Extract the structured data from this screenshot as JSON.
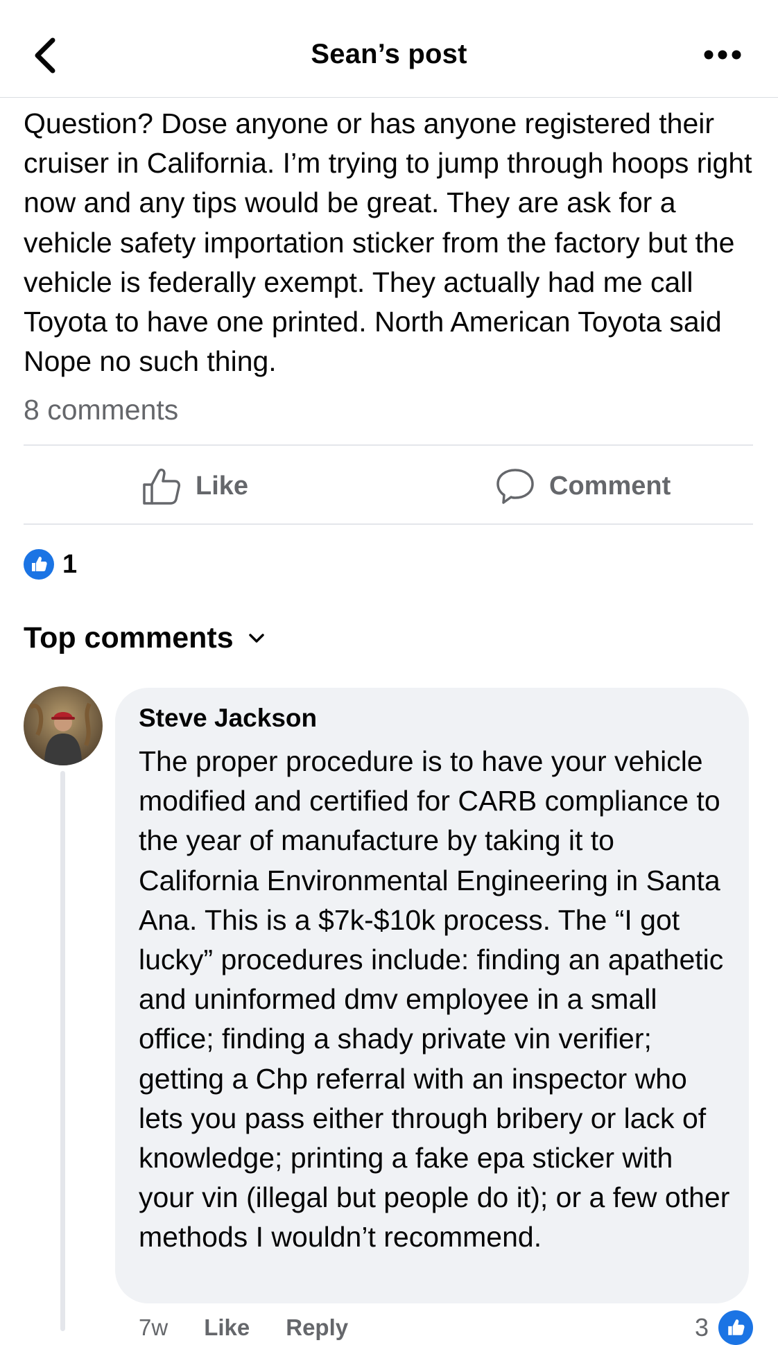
{
  "header": {
    "title": "Sean’s post",
    "back_icon": "chevron-left-icon",
    "more_icon": "ellipsis-icon"
  },
  "post": {
    "text": "Question? Dose anyone or has anyone registered their cruiser in California. I’m trying to jump through hoops right now and any tips would be great. They are ask for a vehicle safety importation sticker from the factory but the vehicle is federally exempt. They actually had me call Toyota to have one printed. North American Toyota said Nope no such thing.",
    "comment_count": "8 comments"
  },
  "actions": {
    "like_label": "Like",
    "comment_label": "Comment"
  },
  "reactions": {
    "count": "1",
    "icon": "thumbs-up-icon",
    "color": "#1b74e4"
  },
  "comments_section": {
    "sort_label": "Top comments",
    "sort_icon": "chevron-down-icon"
  },
  "comment": {
    "author": "Steve Jackson",
    "text": "The proper procedure is to have your vehicle modified and certified for CARB compliance to the year of manufacture by taking it to California Environmental Engineering in Santa Ana. This is a $7k-$10k process. The “I got lucky” procedures include: finding an apathetic and uninformed dmv employee in a small office; finding a shady private vin verifier; getting a Chp referral with an inspector who lets you pass either through bribery or lack of knowledge; printing a fake epa sticker with your vin (illegal but people do it); or a few other methods I wouldn’t recommend.",
    "time": "7w",
    "like_label": "Like",
    "reply_label": "Reply",
    "reaction_count": "3"
  }
}
